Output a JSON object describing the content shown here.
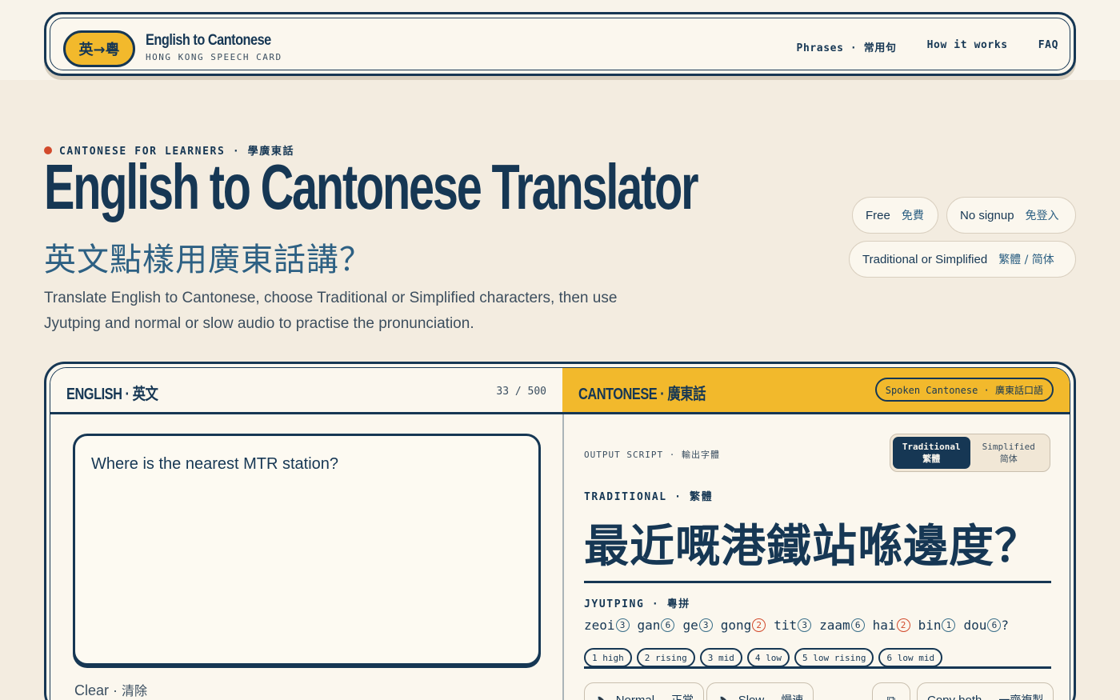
{
  "header": {
    "logo": "英→粵",
    "brand_title": "English to Cantonese",
    "brand_sub": "HONG KONG SPEECH CARD",
    "nav": [
      "Phrases · 常用句",
      "How it works",
      "FAQ"
    ]
  },
  "hero": {
    "eyebrow": "CANTONESE FOR LEARNERS · 學廣東話",
    "title": "English to Cantonese Translator",
    "subtitle_zh": "英文點樣用廣東話講？",
    "description": "Translate English to Cantonese, choose Traditional or Simplified characters, then use Jyutping and normal or slow audio to practise the pronunciation."
  },
  "chips": [
    {
      "en": "Free",
      "zh": "免費"
    },
    {
      "en": "No signup",
      "zh": "免登入"
    },
    {
      "en": "Traditional or Simplified",
      "zh": "繁體 / 简体"
    }
  ],
  "english_pane": {
    "label": "ENGLISH",
    "label_zh": "英文",
    "counter": "33 / 500",
    "input_value": "Where is the nearest MTR station?",
    "clear_label": "Clear",
    "clear_zh": "清除"
  },
  "cantonese_pane": {
    "label": "CANTONESE",
    "label_zh": "廣東話",
    "badge": "Spoken Cantonese · 廣東話口語",
    "output_script_label": "OUTPUT SCRIPT · 輸出字體",
    "script_options": [
      {
        "en": "Traditional",
        "zh": "繁體",
        "active": true
      },
      {
        "en": "Simplified",
        "zh": "简体",
        "active": false
      }
    ],
    "traditional_label": "TRADITIONAL · 繁體",
    "output_text": "最近嘅港鐵站喺邊度？",
    "jyutping_label": "JYUTPING · 粵拼",
    "jyutping": [
      {
        "syl": "zeoi",
        "tone": "3"
      },
      {
        "syl": "gan",
        "tone": "6"
      },
      {
        "syl": "ge",
        "tone": "3"
      },
      {
        "syl": "gong",
        "tone": "2"
      },
      {
        "syl": "tit",
        "tone": "3"
      },
      {
        "syl": "zaam",
        "tone": "6"
      },
      {
        "syl": "hai",
        "tone": "2"
      },
      {
        "syl": "bin",
        "tone": "1"
      },
      {
        "syl": "dou",
        "tone": "6"
      }
    ],
    "jyutping_end": "?",
    "tone_legend": [
      "1 high",
      "2 rising",
      "3 mid",
      "4 low",
      "5 low rising",
      "6 low mid"
    ],
    "audio_normal": "Normal",
    "audio_normal_zh": "正常",
    "audio_slow": "Slow",
    "audio_slow_zh": "慢速",
    "copy_both": "Copy both",
    "copy_both_zh": "一齊複製"
  },
  "colors": {
    "navy": "#163754",
    "yellow": "#f2b92c",
    "red_accent": "#d24a2c",
    "paper": "#fbf7ee"
  }
}
